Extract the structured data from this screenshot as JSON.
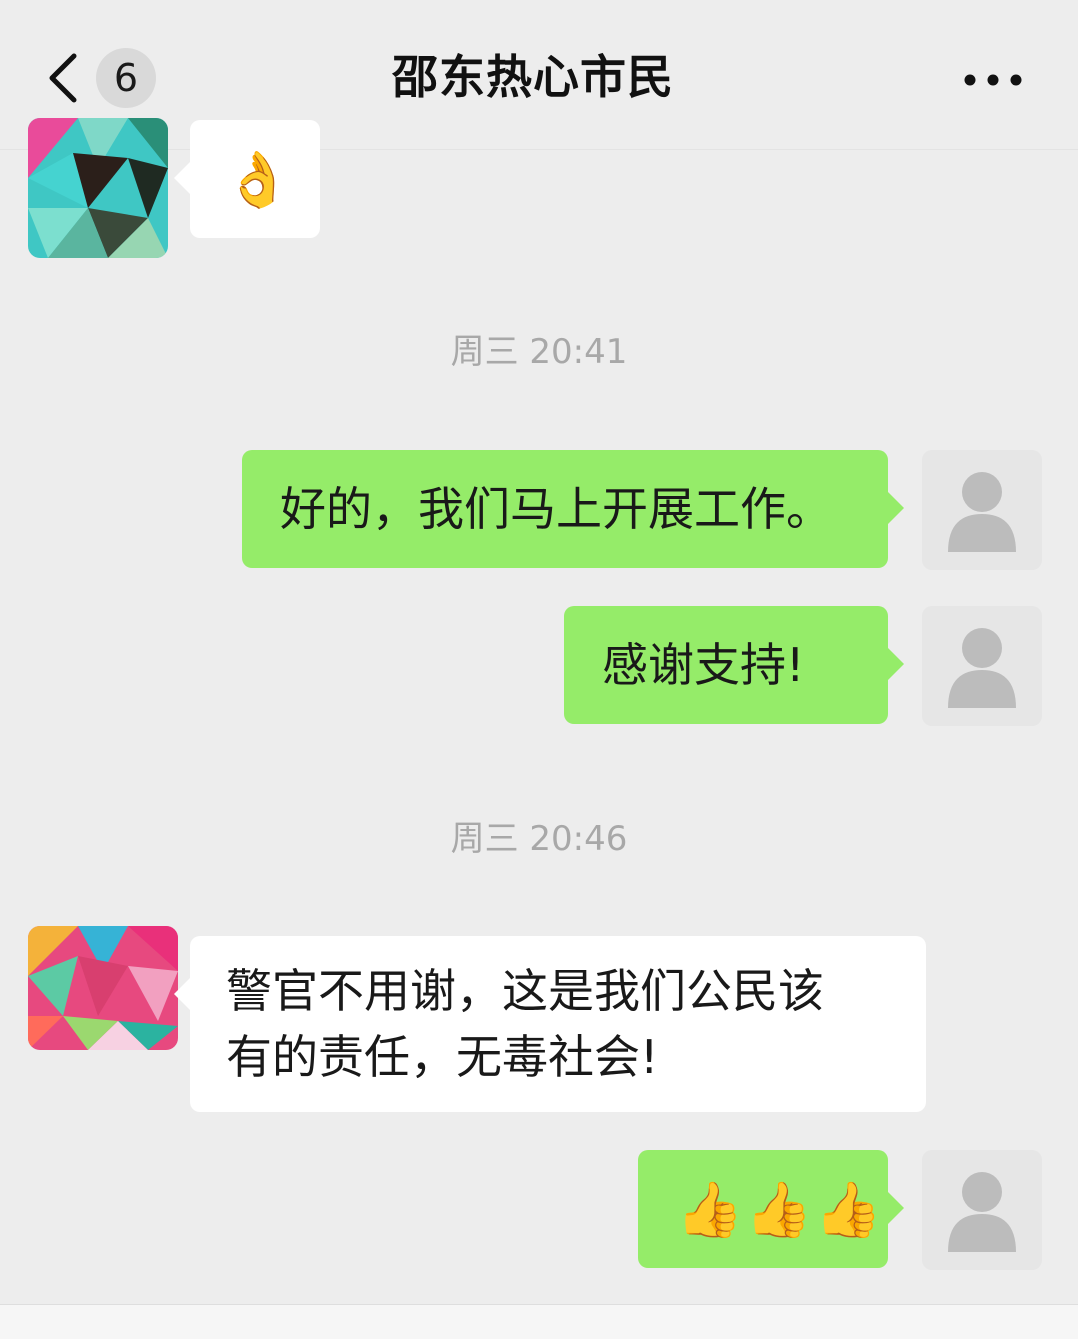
{
  "header": {
    "title": "邵东热心市民",
    "unread_count": "6",
    "back_icon": "chevron-left-icon",
    "more_icon": "more-dots-icon"
  },
  "messages": [
    {
      "type": "emoji",
      "direction": "incoming",
      "content": "👌",
      "emoji_name": "ok-hand"
    },
    {
      "type": "timestamp",
      "text": "周三 20:41"
    },
    {
      "type": "text",
      "direction": "outgoing",
      "content": "好的，我们马上开展工作。"
    },
    {
      "type": "text",
      "direction": "outgoing",
      "content": "感谢支持!"
    },
    {
      "type": "timestamp",
      "text": "周三 20:46"
    },
    {
      "type": "text",
      "direction": "incoming",
      "lines": [
        "警官不用谢，这是我们公民该",
        "有的责任，无毒社会!"
      ]
    },
    {
      "type": "emoji",
      "direction": "outgoing",
      "content": "👍👍👍",
      "emoji_name": "thumbs-up"
    }
  ],
  "colors": {
    "background": "#ededed",
    "outgoing_bubble": "#95ec69",
    "incoming_bubble": "#ffffff",
    "timestamp_text": "#a8a8a8"
  }
}
